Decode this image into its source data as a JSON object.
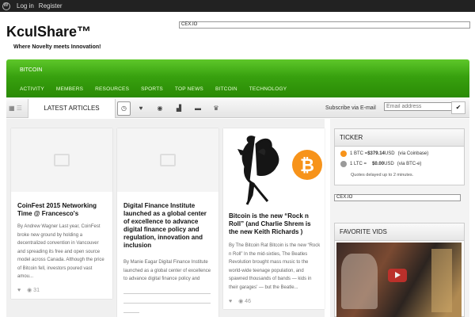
{
  "adminbar": {
    "login": "Log in",
    "register": "Register"
  },
  "header": {
    "brand": "KculShare™",
    "tagline": "Where Novelty meets Innovation!",
    "ticker_widget": "CEX.IO"
  },
  "nav": {
    "top_label": "BITCOIN",
    "items": [
      "ACTIVITY",
      "MEMBERS",
      "RESOURCES",
      "SPORTS",
      "TOP NEWS",
      "BITCOIN",
      "TECHNOLOGY"
    ],
    "accent": "#38a10f"
  },
  "toolbar": {
    "latest_tab": "LATEST ARTICLES",
    "subscribe_label": "Subscribe via E-mail",
    "email_placeholder": "Email address",
    "submit_icon": "checkmark-icon"
  },
  "articles": [
    {
      "title": "CoinFest 2015 Networking Time @ Francesco's",
      "excerpt": "By Andrew Wagner Last year, CoinFest broke new ground by holding a decentralized convention in Vancouver and spreading its free and open source model across Canada. Although the price of Bitcoin fell, investors poured vast amou...",
      "views": "31"
    },
    {
      "title": "Digital Finance Institute launched as a global center of excellence to advance digital finance policy and regulation, innovation and inclusion",
      "excerpt": "By Manie Eagar Digital Finance Institute launched as a global center of excellence to advance digital finance policy and regulation, innovation and inclusion"
    },
    {
      "title": "Bitcoin is the new “Rock n Roll” (and Charlie Shrem is the new Keith Richards )",
      "excerpt": "By The Bitcoin Rat Bitcoin is the new “Rock n Roll” In the mid-sixties, The Beatles Revolution brought mass music to the world-wide teenage population, and spawned thousands of bands — kids in their garages' — but the Beatle...",
      "views": "46"
    }
  ],
  "sidebar": {
    "ticker_title": "TICKER",
    "btc_line": {
      "lead": "1 BTC = ",
      "price": "$379.14",
      "currency": " USD",
      "source": "(via Coinbase)"
    },
    "ltc_line": {
      "lead": "1 LTC = ",
      "price": "$0.00",
      "currency": " USD",
      "source": "(via BTC-e)"
    },
    "delay_note": "Quotes delayed up to 2 minutes.",
    "cex_widget": "CEX.IO",
    "vids_title": "FAVORITE VIDS"
  }
}
